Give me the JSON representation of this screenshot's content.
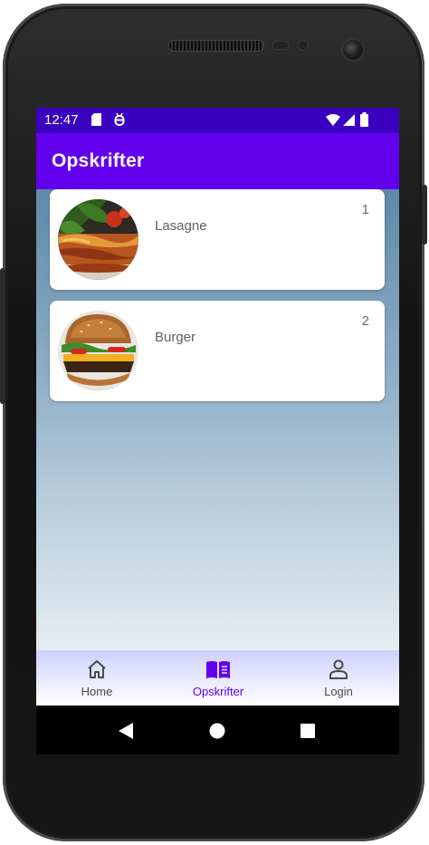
{
  "status_bar": {
    "time": "12:47",
    "icons": [
      "sd-card-icon",
      "usb-debug-icon",
      "wifi-icon",
      "cell-signal-icon",
      "battery-icon"
    ]
  },
  "app_bar": {
    "title": "Opskrifter"
  },
  "recipes": [
    {
      "name": "Lasagne",
      "number": "1",
      "image": "lasagne-photo"
    },
    {
      "name": "Burger",
      "number": "2",
      "image": "burger-photo"
    }
  ],
  "bottom_nav": {
    "items": [
      {
        "label": "Home",
        "icon": "home-icon",
        "active": false
      },
      {
        "label": "Opskrifter",
        "icon": "book-icon",
        "active": true
      },
      {
        "label": "Login",
        "icon": "person-icon",
        "active": false
      }
    ]
  },
  "system_nav": {
    "buttons": [
      "back-icon",
      "home-circle-icon",
      "recents-icon"
    ]
  },
  "colors": {
    "status_bar": "#3a00c0",
    "app_bar": "#6200ee",
    "nav_active": "#6200ee",
    "nav_inactive": "#4a4a4a"
  }
}
